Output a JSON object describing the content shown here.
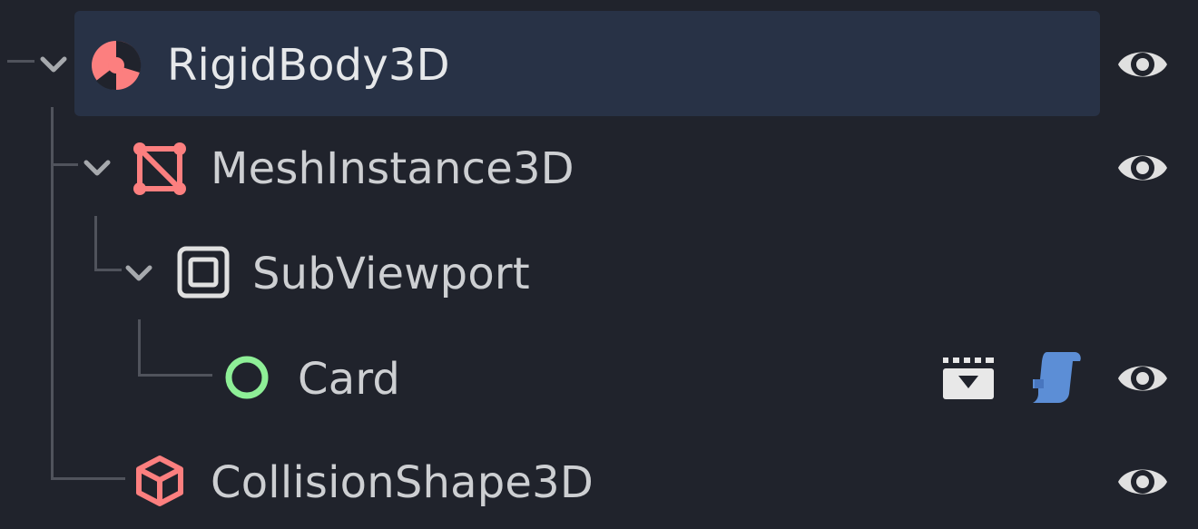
{
  "scene_tree": {
    "nodes": [
      {
        "name": "RigidBody3D",
        "icon": "rigidbody-icon",
        "selected": true
      },
      {
        "name": "MeshInstance3D",
        "icon": "mesh-instance-icon"
      },
      {
        "name": "SubViewport",
        "icon": "subviewport-icon"
      },
      {
        "name": "Card",
        "icon": "node2d-circle-icon",
        "extras": [
          "open-scene-icon",
          "script-icon"
        ]
      },
      {
        "name": "CollisionShape3D",
        "icon": "collision-shape-icon"
      }
    ]
  },
  "colors": {
    "background": "#20232c",
    "selected_row": "#283246",
    "node3d_red": "#fc7f7f",
    "node2d_green": "#8eef97",
    "script_blue": "#5c8ed6",
    "text": "#cdcfd2"
  }
}
